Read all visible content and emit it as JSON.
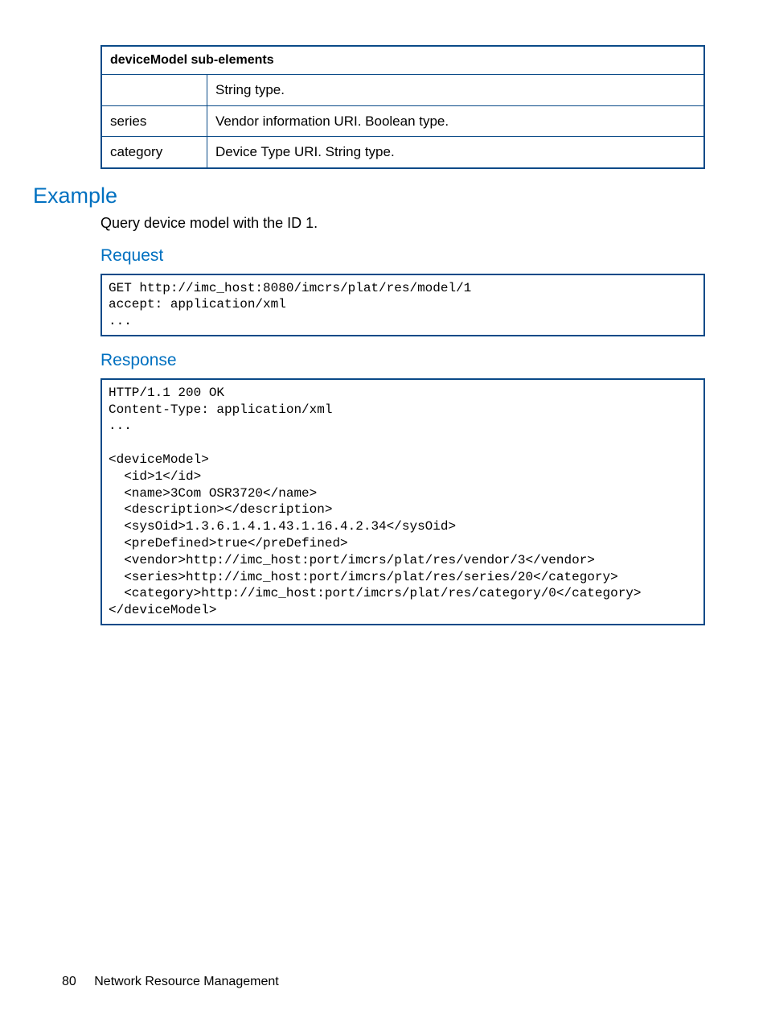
{
  "table": {
    "header": "deviceModel sub-elements",
    "rows": [
      {
        "key": "",
        "val": "String type."
      },
      {
        "key": "series",
        "val": "Vendor information URI.\nBoolean type."
      },
      {
        "key": "category",
        "val": "Device Type URI.\nString type."
      }
    ]
  },
  "example_heading": "Example",
  "example_desc": "Query device model with the ID 1.",
  "request_heading": "Request",
  "request_code": "GET http://imc_host:8080/imcrs/plat/res/model/1\naccept: application/xml\n...",
  "response_heading": "Response",
  "response_code": "HTTP/1.1 200 OK\nContent-Type: application/xml\n...\n\n<deviceModel>\n  <id>1</id>\n  <name>3Com OSR3720</name>\n  <description></description>\n  <sysOid>1.3.6.1.4.1.43.1.16.4.2.34</sysOid>\n  <preDefined>true</preDefined>\n  <vendor>http://imc_host:port/imcrs/plat/res/vendor/3</vendor>\n  <series>http://imc_host:port/imcrs/plat/res/series/20</category>\n  <category>http://imc_host:port/imcrs/plat/res/category/0</category>\n</deviceModel>",
  "footer": {
    "page_number": "80",
    "section_title": "Network Resource Management"
  }
}
